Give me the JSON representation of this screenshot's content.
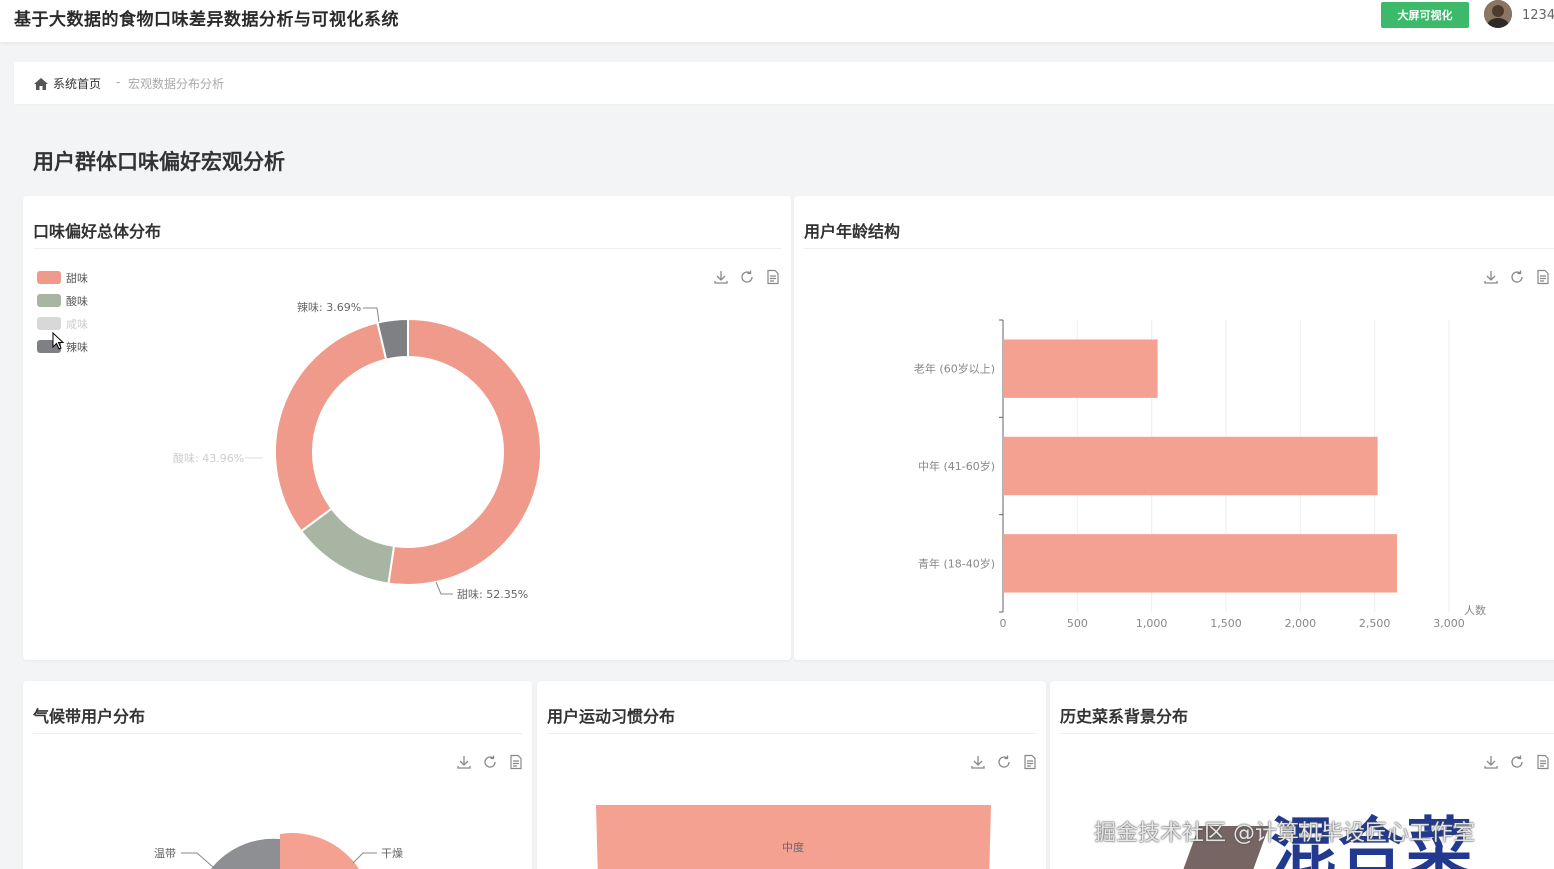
{
  "app": {
    "title": "基于大数据的食物口味差异数据分析与可视化系统",
    "bigscreen_button": "大屏可视化",
    "username": "1234"
  },
  "breadcrumb": {
    "home": "系统首页",
    "separator": "-",
    "current": "宏观数据分布分析"
  },
  "page_title": "用户群体口味偏好宏观分析",
  "cards": {
    "taste": {
      "title": "口味偏好总体分布"
    },
    "age": {
      "title": "用户年龄结构"
    },
    "climate": {
      "title": "气候带用户分布"
    },
    "exercise": {
      "title": "用户运动习惯分布"
    },
    "cuisine": {
      "title": "历史菜系背景分布"
    }
  },
  "toolbox_icons": [
    "download-icon",
    "refresh-icon",
    "data-view-icon"
  ],
  "colors": {
    "sweet": "#ef9a8a",
    "sour": "#a9b5a3",
    "salty": "#d8d8d8",
    "spicy": "#7f8083",
    "bar": "#f5a191",
    "accent_green": "#3cba6a"
  },
  "chart_data": [
    {
      "type": "pie",
      "variant": "donut",
      "legend": [
        "甜味",
        "酸味",
        "咸味",
        "辣味"
      ],
      "legend_disabled": [
        "咸味"
      ],
      "slices": [
        {
          "name": "甜味",
          "percent": 52.35
        },
        {
          "name": "酸味",
          "percent": 43.96
        },
        {
          "name": "辣味",
          "percent": 3.69
        }
      ],
      "labels": {
        "sweet": "甜味: 52.35%",
        "sour": "酸味: 43.96%",
        "spicy": "辣味: 3.69%"
      },
      "sour_arc_shares": {
        "dark_green": 12.5,
        "salmon": 31.46
      }
    },
    {
      "type": "bar",
      "orientation": "horizontal",
      "categories": [
        "老年 (60岁以上)",
        "中年 (41-60岁)",
        "青年 (18-40岁)"
      ],
      "values": [
        1040,
        2520,
        2650
      ],
      "xlim": [
        0,
        3000
      ],
      "ticks": [
        0,
        500,
        1000,
        1500,
        2000,
        2500,
        3000
      ],
      "tick_labels": [
        "0",
        "500",
        "1,000",
        "1,500",
        "2,000",
        "2,500",
        "3,000"
      ],
      "xlabel": "人数"
    },
    {
      "type": "pie",
      "labels": {
        "left": "温带",
        "right": "干燥"
      }
    },
    {
      "type": "funnel",
      "labels": {
        "top": "中度"
      }
    }
  ],
  "watermark": "掘金技术社区 @计算机毕设匠心工作室",
  "cuisine_bg_text": "混合菜"
}
